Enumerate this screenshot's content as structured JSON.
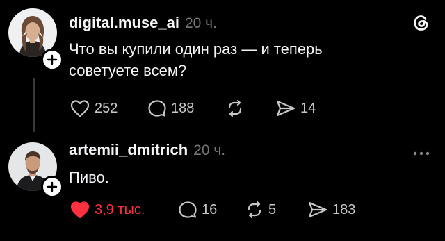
{
  "post1": {
    "username": "digital.muse_ai",
    "time": "20 ч.",
    "text_line1": "Что вы купили один раз — и теперь",
    "text_line2": "советуете всем?",
    "likes": "252",
    "comments": "188",
    "shares": "14",
    "avatar_icon": "user-avatar-woman",
    "liked": false
  },
  "post2": {
    "username": "artemii_dmitrich",
    "time": "20 ч.",
    "text": "Пиво.",
    "likes": "3,9 тыс.",
    "comments": "16",
    "reposts": "5",
    "shares": "183",
    "avatar_icon": "user-avatar-man",
    "liked": true
  },
  "icons": {
    "brand": "threads-logo",
    "like": "heart-icon",
    "comment": "speech-bubble-icon",
    "repost": "repost-arrows-icon",
    "share": "paper-plane-icon",
    "more": "more-dots-icon",
    "follow": "plus-icon"
  },
  "colors": {
    "background": "#000000",
    "text": "#f3f5f7",
    "muted": "#777777",
    "like_active": "#ff3040"
  }
}
